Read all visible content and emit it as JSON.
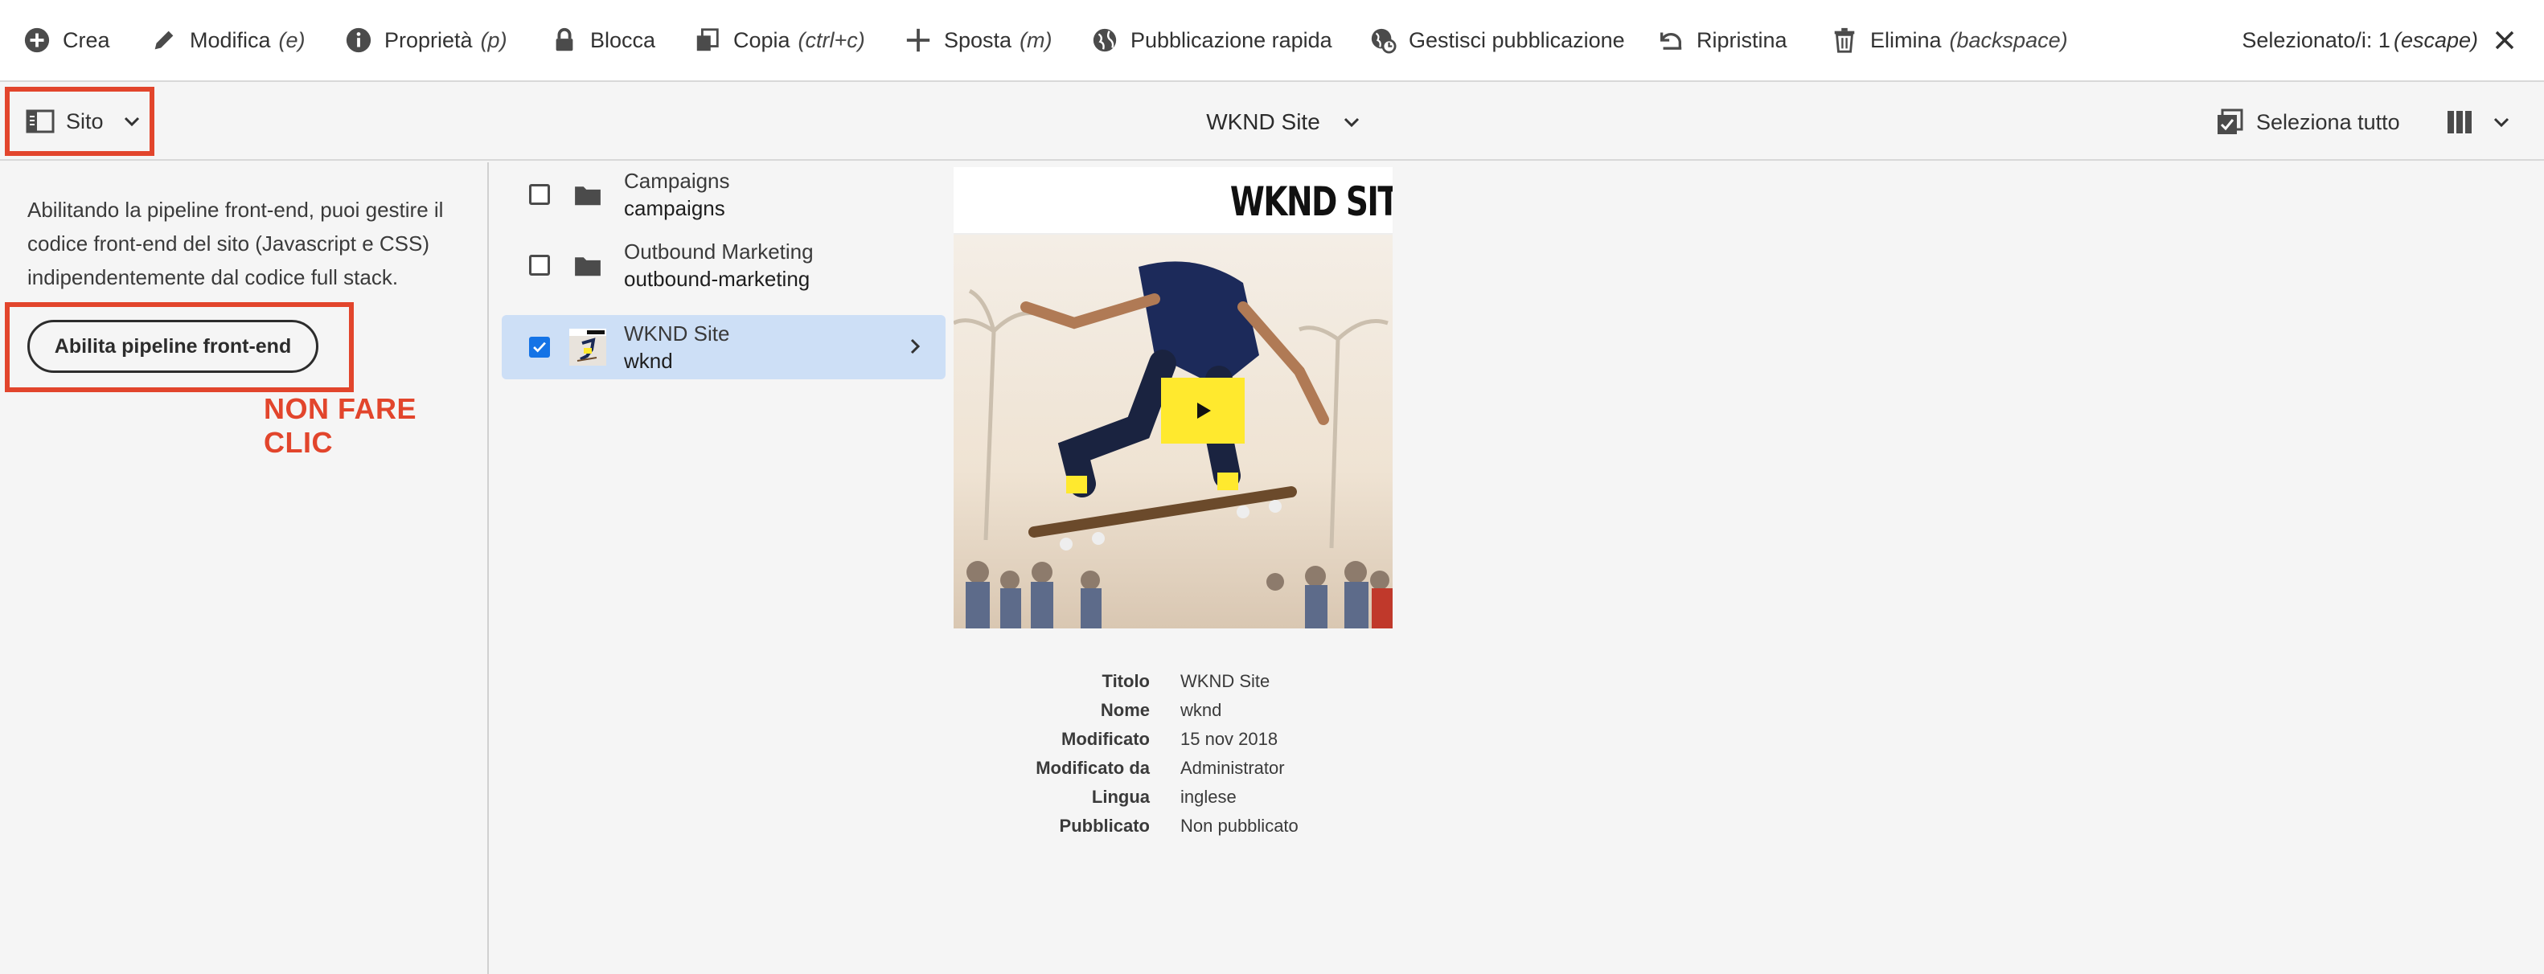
{
  "actionbar": {
    "items": [
      {
        "label": "Crea",
        "shortcut": "",
        "icon": "add-circle-icon"
      },
      {
        "label": "Modifica",
        "shortcut": "(e)",
        "icon": "pencil-icon"
      },
      {
        "label": "Proprietà",
        "shortcut": "(p)",
        "icon": "info-icon"
      },
      {
        "label": "Blocca",
        "shortcut": "",
        "icon": "lock-icon"
      },
      {
        "label": "Copia",
        "shortcut": "(ctrl+c)",
        "icon": "copy-icon"
      },
      {
        "label": "Sposta",
        "shortcut": "(m)",
        "icon": "move-icon"
      },
      {
        "label": "Pubblicazione rapida",
        "shortcut": "",
        "icon": "globe-icon"
      },
      {
        "label": "Gestisci pubblicazione",
        "shortcut": "",
        "icon": "globe-clock-icon"
      },
      {
        "label": "Ripristina",
        "shortcut": "",
        "icon": "undo-icon"
      },
      {
        "label": "Elimina",
        "shortcut": "(backspace)",
        "icon": "trash-icon"
      }
    ],
    "selected_label": "Selezionato/i: 1",
    "selected_shortcut": "(escape)"
  },
  "secondbar": {
    "rail_label": "Sito",
    "title": "WKND Site",
    "select_all": "Seleziona tutto"
  },
  "rail": {
    "description": "Abilitando la pipeline front-end, puoi gestire il codice front-end del sito (Javascript e CSS) indipendentemente dal codice full stack.",
    "cta": "Abilita pipeline front-end",
    "annotation": "NON FARE CLIC",
    "annotation_color": "#e2452c"
  },
  "column": {
    "items": [
      {
        "title": "Campaigns",
        "name": "campaigns",
        "type": "folder",
        "selected": false
      },
      {
        "title": "Outbound Marketing",
        "name": "outbound-marketing",
        "type": "folder",
        "selected": false
      },
      {
        "title": "WKND Site",
        "name": "wknd",
        "type": "page",
        "selected": true
      }
    ]
  },
  "preview": {
    "logo_text": "WKND SIT"
  },
  "meta": {
    "rows": [
      {
        "key": "Titolo",
        "value": "WKND Site"
      },
      {
        "key": "Nome",
        "value": "wknd"
      },
      {
        "key": "Modificato",
        "value": "15 nov 2018"
      },
      {
        "key": "Modificato da",
        "value": "Administrator"
      },
      {
        "key": "Lingua",
        "value": "inglese"
      },
      {
        "key": "Pubblicato",
        "value": "Non pubblicato"
      }
    ]
  },
  "colors": {
    "accent_blue": "#1473e6",
    "selection": "#cddff6",
    "highlight_red": "#e2452c",
    "play_yellow": "#ffe92e"
  }
}
